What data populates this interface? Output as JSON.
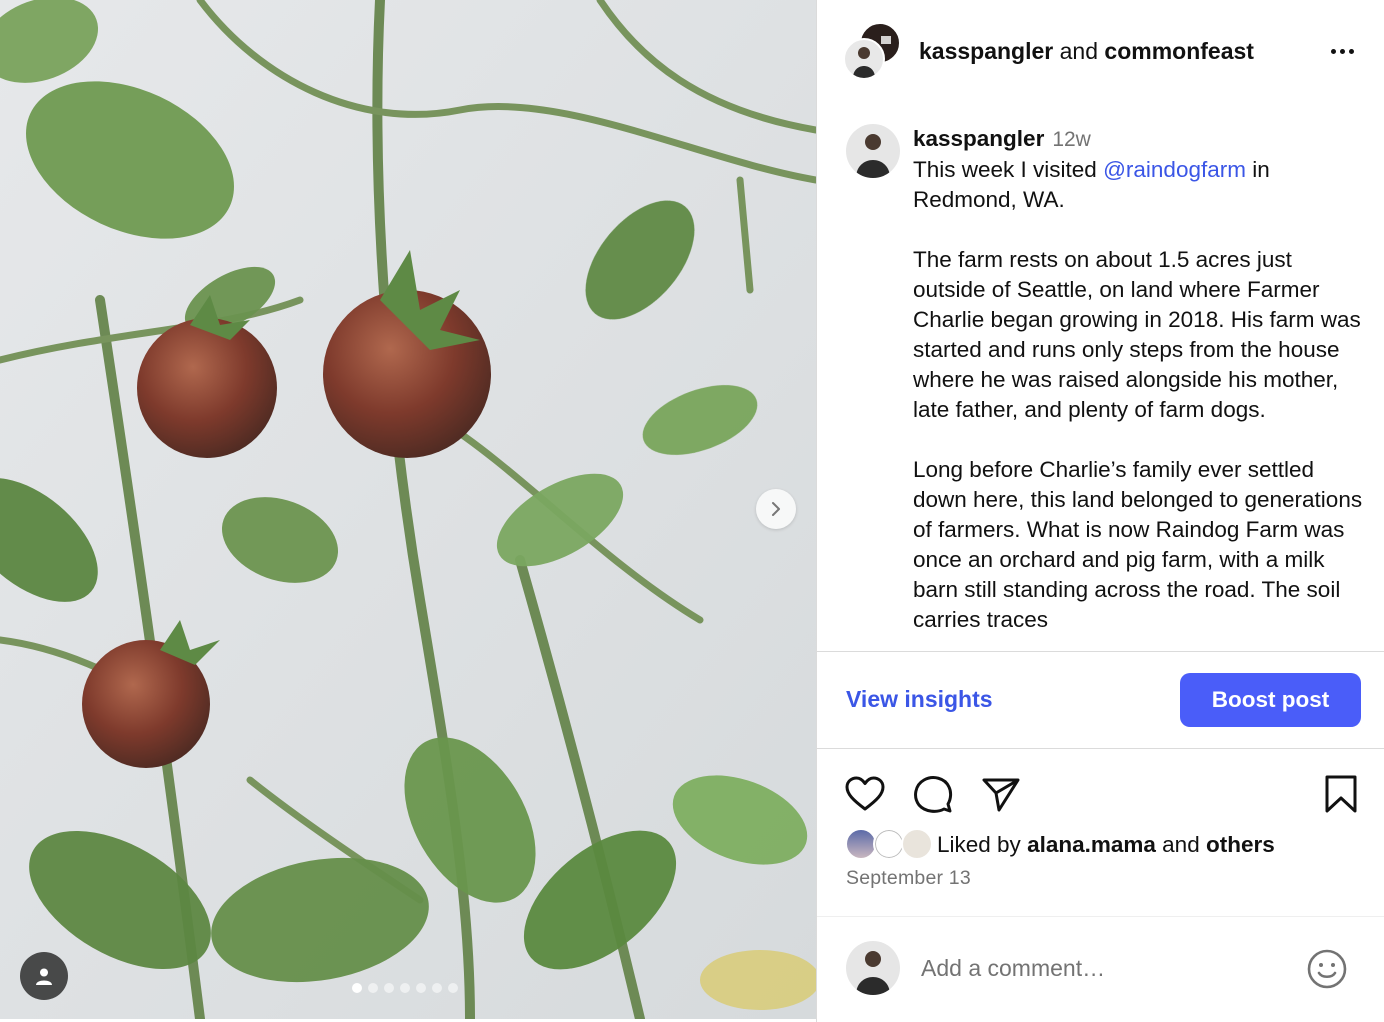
{
  "post": {
    "header": {
      "user1": "kasspangler",
      "joiner": "and",
      "user2": "commonfeast"
    },
    "caption": {
      "username": "kasspangler",
      "time_ago": "12w",
      "line1_prefix": "This week I visited ",
      "mention": "@raindogfarm",
      "line1_suffix": " in Redmond, WA.",
      "paragraph2": "The farm rests on about 1.5 acres just outside of Seattle, on land where Farmer Charlie began growing in 2018. His farm was started and runs only steps from the house where he was raised alongside his mother, late father, and plenty of farm dogs.",
      "paragraph3": "Long before Charlie’s family ever settled down here, this land belonged to generations of farmers. What is now Raindog Farm was once an orchard and pig farm, with a milk barn still standing across the road. The soil carries traces"
    },
    "insights": {
      "view_label": "View insights",
      "boost_label": "Boost post"
    },
    "likes": {
      "prefix": "Liked by",
      "first_liker": "alana.mama",
      "joiner": "and",
      "others": "others"
    },
    "date": "September 13",
    "comment": {
      "placeholder": "Add a comment…"
    },
    "carousel": {
      "current_index": 1,
      "total": 7
    },
    "icons": {
      "more": "more-horizontal-icon",
      "like": "heart-icon",
      "comment": "comment-bubble-icon",
      "share": "paper-plane-icon",
      "save": "bookmark-icon",
      "emoji": "smiley-icon",
      "next": "chevron-right-icon",
      "tag": "user-tag-icon"
    },
    "colors": {
      "link": "#3b56e6",
      "boost_button": "#4a5df9",
      "muted_text": "#737373"
    }
  }
}
